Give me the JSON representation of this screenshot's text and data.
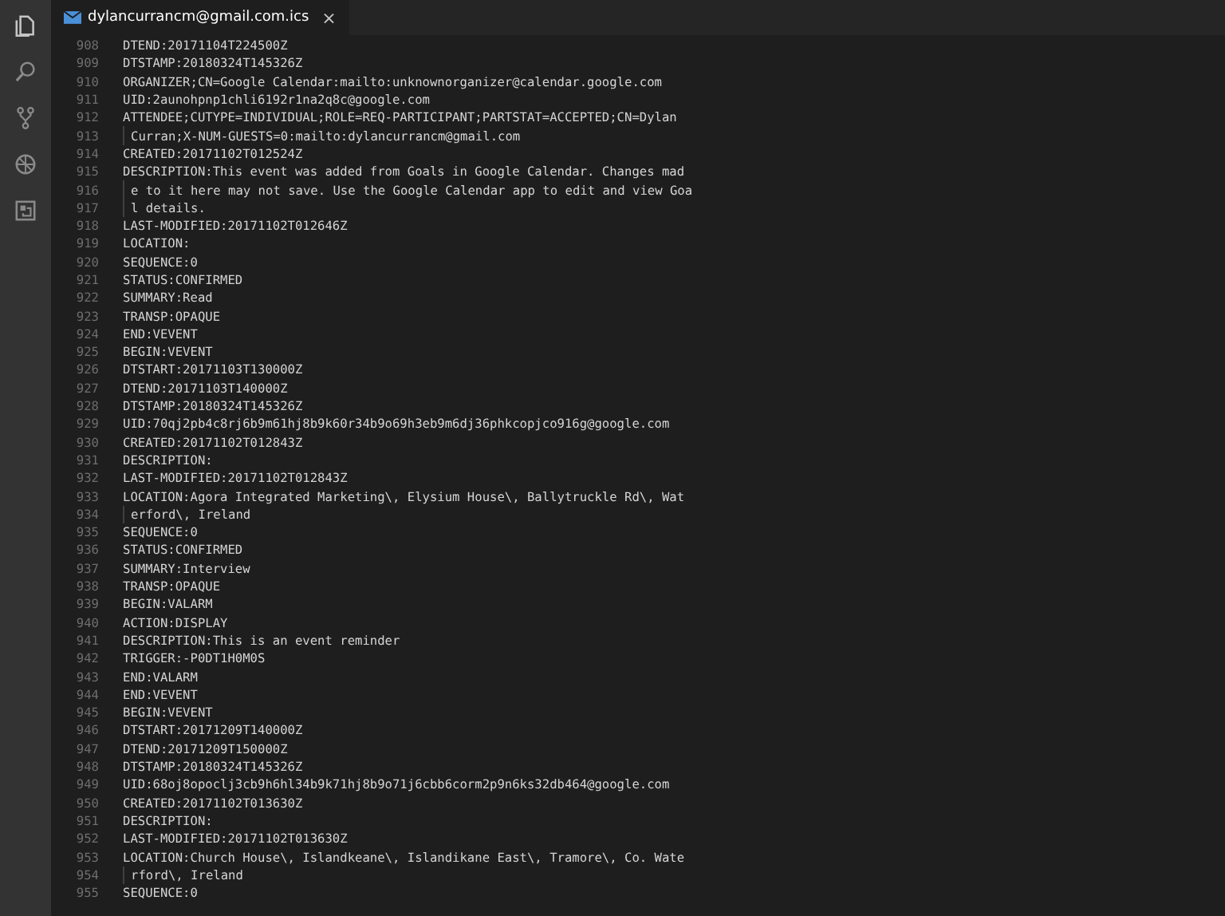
{
  "tab": {
    "title": "dylancurrancm@gmail.com.ics",
    "close": "×",
    "selected": true
  },
  "lines": [
    {
      "number": "908",
      "text": "DTEND:20171104T224500Z",
      "kind": "line"
    },
    {
      "number": "909",
      "text": "DTSTAMP:20180324T145326Z",
      "kind": "line"
    },
    {
      "number": "910",
      "text": "ORGANIZER;CN=Google Calendar:mailto:unknownorganizer@calendar.google.com",
      "kind": "line"
    },
    {
      "number": "911",
      "text": "UID:2aunohpnp1chli6192r1na2q8c@google.com",
      "kind": "line"
    },
    {
      "number": "912",
      "text": "ATTENDEE;CUTYPE=INDIVIDUAL;ROLE=REQ-PARTICIPANT;PARTSTAT=ACCEPTED;CN=Dylan",
      "kind": "line"
    },
    {
      "number": "913",
      "text": "Curran;X-NUM-GUESTS=0:mailto:dylancurrancm@gmail.com",
      "kind": "wrap"
    },
    {
      "number": "914",
      "text": "CREATED:20171102T012524Z",
      "kind": "line"
    },
    {
      "number": "915",
      "text": "DESCRIPTION:This event was added from Goals in Google Calendar. Changes mad",
      "kind": "line"
    },
    {
      "number": "916",
      "text": "e to it here may not save. Use the Google Calendar app to edit and view Goa",
      "kind": "wrap"
    },
    {
      "number": "917",
      "text": "l details.",
      "kind": "wrap"
    },
    {
      "number": "918",
      "text": "LAST-MODIFIED:20171102T012646Z",
      "kind": "line"
    },
    {
      "number": "919",
      "text": "LOCATION:",
      "kind": "line"
    },
    {
      "number": "920",
      "text": "SEQUENCE:0",
      "kind": "line"
    },
    {
      "number": "921",
      "text": "STATUS:CONFIRMED",
      "kind": "line"
    },
    {
      "number": "922",
      "text": "SUMMARY:Read",
      "kind": "line"
    },
    {
      "number": "923",
      "text": "TRANSP:OPAQUE",
      "kind": "line"
    },
    {
      "number": "924",
      "text": "END:VEVENT",
      "kind": "line"
    },
    {
      "number": "925",
      "text": "BEGIN:VEVENT",
      "kind": "line"
    },
    {
      "number": "926",
      "text": "DTSTART:20171103T130000Z",
      "kind": "line"
    },
    {
      "number": "927",
      "text": "DTEND:20171103T140000Z",
      "kind": "line"
    },
    {
      "number": "928",
      "text": "DTSTAMP:20180324T145326Z",
      "kind": "line"
    },
    {
      "number": "929",
      "text": "UID:70qj2pb4c8rj6b9m61hj8b9k60r34b9o69h3eb9m6dj36phkcopjco916g@google.com",
      "kind": "line"
    },
    {
      "number": "930",
      "text": "CREATED:20171102T012843Z",
      "kind": "line"
    },
    {
      "number": "931",
      "text": "DESCRIPTION:",
      "kind": "line"
    },
    {
      "number": "932",
      "text": "LAST-MODIFIED:20171102T012843Z",
      "kind": "line"
    },
    {
      "number": "933",
      "text": "LOCATION:Agora Integrated Marketing\\, Elysium House\\, Ballytruckle Rd\\, Wat",
      "kind": "line"
    },
    {
      "number": "934",
      "text": "erford\\, Ireland",
      "kind": "wrap"
    },
    {
      "number": "935",
      "text": "SEQUENCE:0",
      "kind": "line"
    },
    {
      "number": "936",
      "text": "STATUS:CONFIRMED",
      "kind": "line"
    },
    {
      "number": "937",
      "text": "SUMMARY:Interview",
      "kind": "line"
    },
    {
      "number": "938",
      "text": "TRANSP:OPAQUE",
      "kind": "line"
    },
    {
      "number": "939",
      "text": "BEGIN:VALARM",
      "kind": "line"
    },
    {
      "number": "940",
      "text": "ACTION:DISPLAY",
      "kind": "line"
    },
    {
      "number": "941",
      "text": "DESCRIPTION:This is an event reminder",
      "kind": "line"
    },
    {
      "number": "942",
      "text": "TRIGGER:-P0DT1H0M0S",
      "kind": "line"
    },
    {
      "number": "943",
      "text": "END:VALARM",
      "kind": "line"
    },
    {
      "number": "944",
      "text": "END:VEVENT",
      "kind": "line"
    },
    {
      "number": "945",
      "text": "BEGIN:VEVENT",
      "kind": "line"
    },
    {
      "number": "946",
      "text": "DTSTART:20171209T140000Z",
      "kind": "line"
    },
    {
      "number": "947",
      "text": "DTEND:20171209T150000Z",
      "kind": "line"
    },
    {
      "number": "948",
      "text": "DTSTAMP:20180324T145326Z",
      "kind": "line"
    },
    {
      "number": "949",
      "text": "UID:68oj8opoclj3cb9h6hl34b9k71hj8b9o71j6cbb6corm2p9n6ks32db464@google.com",
      "kind": "line"
    },
    {
      "number": "950",
      "text": "CREATED:20171102T013630Z",
      "kind": "line"
    },
    {
      "number": "951",
      "text": "DESCRIPTION:",
      "kind": "line"
    },
    {
      "number": "952",
      "text": "LAST-MODIFIED:20171102T013630Z",
      "kind": "line"
    },
    {
      "number": "953",
      "text": "LOCATION:Church House\\, Islandkeane\\, Islandikane East\\, Tramore\\, Co. Wate",
      "kind": "line"
    },
    {
      "number": "954",
      "text": "rford\\, Ireland",
      "kind": "wrap"
    },
    {
      "number": "955",
      "text": "SEQUENCE:0",
      "kind": "line"
    }
  ]
}
